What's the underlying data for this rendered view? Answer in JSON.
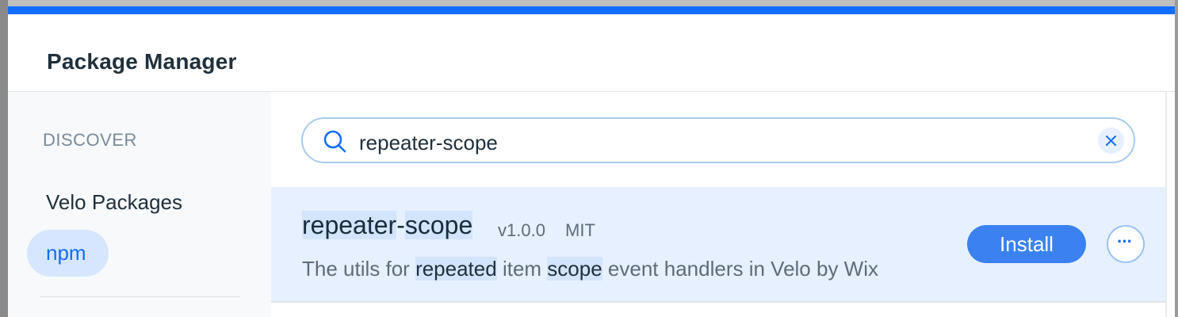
{
  "modal": {
    "title": "Package Manager"
  },
  "sidebar": {
    "section_heading": "DISCOVER",
    "items": [
      {
        "label": "Velo Packages",
        "selected": false
      },
      {
        "label": "npm",
        "selected": true
      }
    ]
  },
  "search": {
    "value": "repeater-scope",
    "icon": "search-icon",
    "clear_icon": "close-icon"
  },
  "results": [
    {
      "name_parts": [
        "repeater",
        "-",
        "scope"
      ],
      "version": "v1.0.0",
      "license": "MIT",
      "description_parts": [
        "The utils for ",
        "repeated",
        " item ",
        "scope",
        " event handlers in Velo by Wix"
      ],
      "install_label": "Install",
      "more_label": "···"
    }
  ],
  "colors": {
    "accent": "#116dff",
    "row_highlight": "#e7f0ff",
    "install_button": "#3b82f0"
  }
}
